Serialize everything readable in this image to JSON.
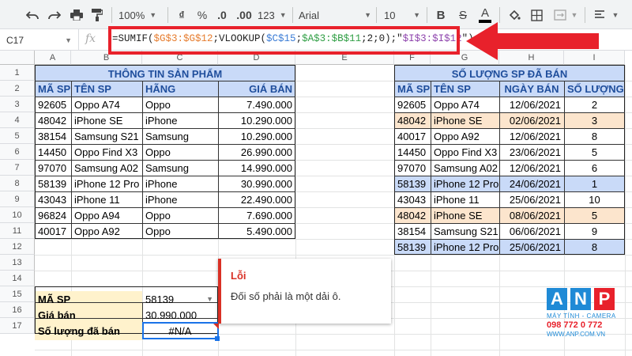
{
  "toolbar": {
    "zoom": "100%",
    "currency": "₫",
    "percent": "%",
    "dec_less": ".0",
    "dec_more": ".00",
    "num_format": "123",
    "font": "Arial",
    "font_size": "10",
    "bold": "B",
    "strike": "S",
    "text_color": "A"
  },
  "formula_bar": {
    "cell_ref": "C17",
    "fx": "fx",
    "formula": {
      "p1": "=SUMIF(",
      "p2": "$G$3:$G$12",
      "p3": ";VLOOKUP(",
      "p4": "$C$15",
      "p5": ";",
      "p6": "$A$3:$B$11",
      "p7": ";2;0);\"",
      "p8": "$I$3:$I$12",
      "p9": "\")"
    }
  },
  "columns": [
    "A",
    "B",
    "C",
    "D",
    "E",
    "F",
    "G",
    "H",
    "I"
  ],
  "rows": [
    "1",
    "2",
    "3",
    "4",
    "5",
    "6",
    "7",
    "8",
    "9",
    "10",
    "11",
    "12",
    "13",
    "14",
    "15",
    "16",
    "17"
  ],
  "product_table": {
    "title": "THÔNG TIN SẢN PHẨM",
    "headers": [
      "MÃ SP",
      "TÊN SP",
      "HÃNG",
      "GIÁ BÁN"
    ],
    "rows": [
      [
        "92605",
        "Oppo A74",
        "Oppo",
        "7.490.000"
      ],
      [
        "48042",
        "iPhone SE",
        "iPhone",
        "10.290.000"
      ],
      [
        "38154",
        "Samsung S21",
        "Samsung",
        "10.290.000"
      ],
      [
        "14450",
        "Oppo Find X3",
        "Oppo",
        "26.990.000"
      ],
      [
        "97070",
        "Samsung A02",
        "Samsung",
        "14.990.000"
      ],
      [
        "58139",
        "iPhone 12 Pro",
        "iPhone",
        "30.990.000"
      ],
      [
        "43043",
        "iPhone 11",
        "iPhone",
        "22.490.000"
      ],
      [
        "96824",
        "Oppo A94",
        "Oppo",
        "7.690.000"
      ],
      [
        "40017",
        "Oppo A92",
        "Oppo",
        "5.490.000"
      ]
    ]
  },
  "sales_table": {
    "title": "SỐ LƯỢNG SP ĐÃ BÁN",
    "headers": [
      "MÃ SP",
      "TÊN SP",
      "NGÀY BÁN",
      "SỐ LƯỢNG"
    ],
    "rows": [
      [
        "92605",
        "Oppo A74",
        "12/06/2021",
        "2"
      ],
      [
        "48042",
        "iPhone SE",
        "02/06/2021",
        "3"
      ],
      [
        "40017",
        "Oppo A92",
        "12/06/2021",
        "8"
      ],
      [
        "14450",
        "Oppo Find X3",
        "23/06/2021",
        "5"
      ],
      [
        "97070",
        "Samsung A02",
        "12/06/2021",
        "6"
      ],
      [
        "58139",
        "iPhone 12 Pro",
        "24/06/2021",
        "1"
      ],
      [
        "43043",
        "iPhone 11",
        "25/06/2021",
        "10"
      ],
      [
        "48042",
        "iPhone SE",
        "08/06/2021",
        "5"
      ],
      [
        "38154",
        "Samsung S21",
        "06/06/2021",
        "9"
      ],
      [
        "58139",
        "iPhone 12 Pro",
        "25/06/2021",
        "8"
      ]
    ]
  },
  "lookup": {
    "label_code": "MÃ SP",
    "value_code": "58139",
    "label_price": "Giá bán",
    "value_price": "30.990.000",
    "label_qty": "Số lượng đã bán",
    "value_qty": "#N/A"
  },
  "error_tooltip": {
    "title": "Lỗi",
    "message": "Đối số phải là một dải ô."
  },
  "watermark": {
    "brand": [
      "A",
      "N",
      "P"
    ],
    "tagline": "MÁY TÍNH - CAMERA",
    "phone": "098 772 0 772",
    "site": "WWW.ANP.COM.VN"
  },
  "colors": {
    "header_fill": "#c9daf8",
    "orange_fill": "#fce5cd",
    "blue_fill": "#c9daf8",
    "yellow_fill": "#fff2cc",
    "title_text": "#1f4e9c",
    "annotation_red": "#e8212b"
  }
}
